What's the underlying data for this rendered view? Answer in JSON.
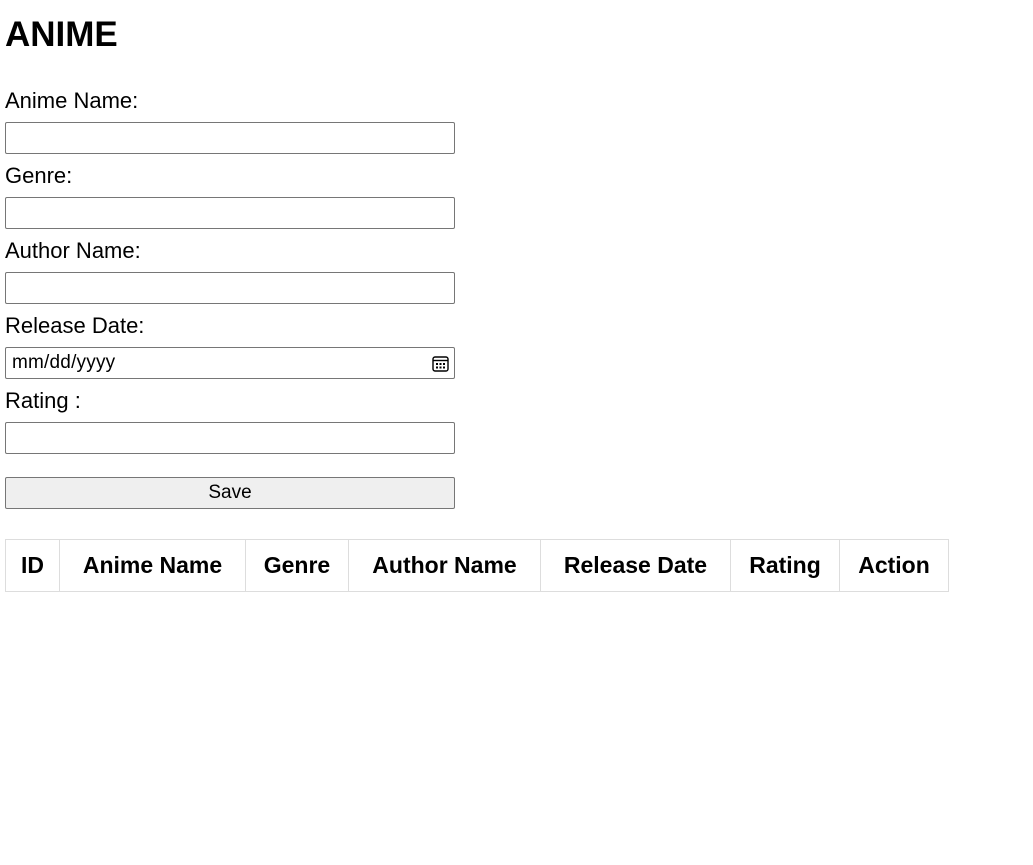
{
  "page": {
    "title": "ANIME"
  },
  "form": {
    "anime_name_label": "Anime Name:",
    "anime_name_value": "",
    "genre_label": "Genre:",
    "genre_value": "",
    "author_name_label": "Author Name:",
    "author_name_value": "",
    "release_date_label": "Release Date:",
    "release_date_placeholder": "mm/dd/yyyy",
    "rating_label": "Rating :",
    "rating_value": "",
    "save_label": "Save"
  },
  "table": {
    "headers": [
      "ID",
      "Anime Name",
      "Genre",
      "Author Name",
      "Release Date",
      "Rating",
      "Action"
    ],
    "rows": []
  },
  "icons": {
    "date_picker": "calendar-icon"
  }
}
